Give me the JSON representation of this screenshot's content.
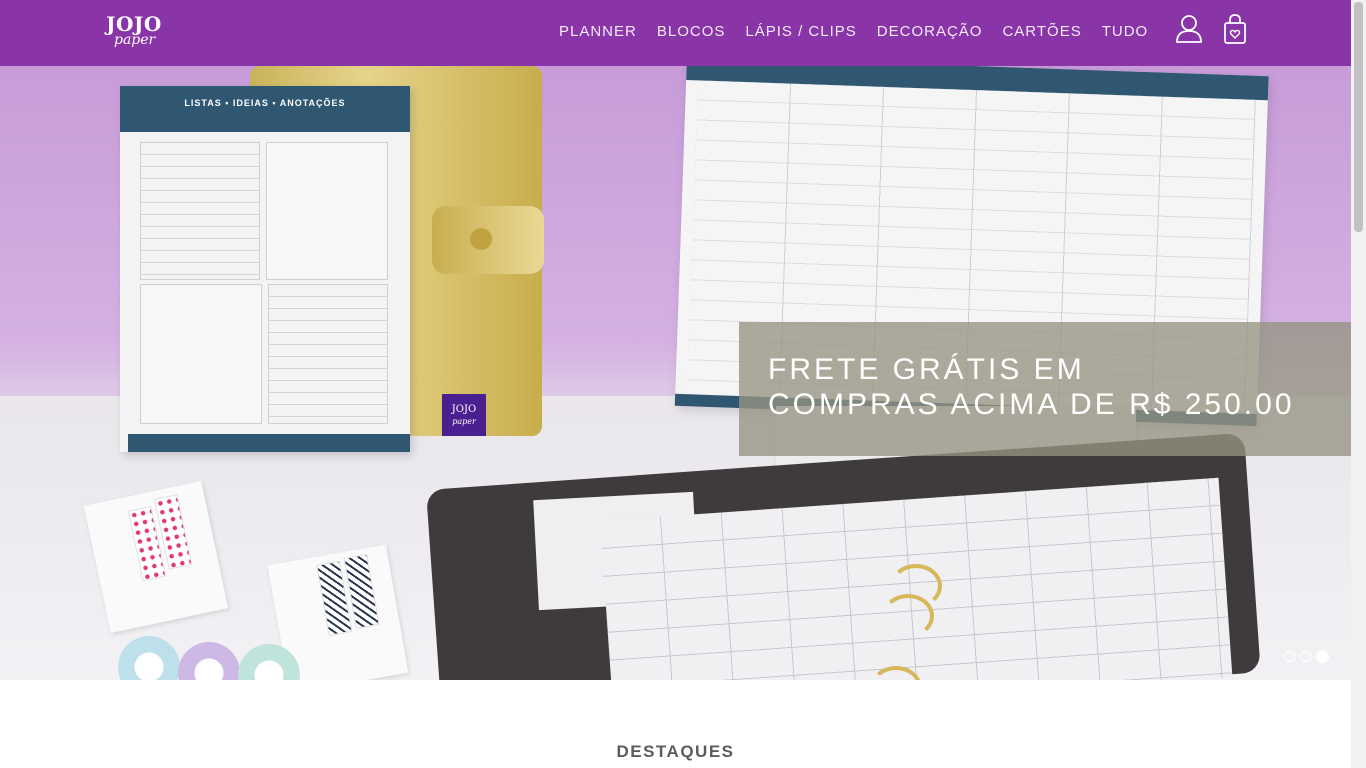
{
  "header": {
    "logo_main": "JOJO",
    "logo_sub": "paper",
    "nav": [
      {
        "label": "PLANNER"
      },
      {
        "label": "BLOCOS"
      },
      {
        "label": "LÁPIS / CLIPS"
      },
      {
        "label": "DECORAÇÃO"
      },
      {
        "label": "CARTÕES"
      },
      {
        "label": "TUDO"
      }
    ],
    "icons": {
      "account": "user-icon",
      "cart": "shopping-bag-icon"
    },
    "background": "#8a35a7"
  },
  "hero": {
    "notepad_title": "LISTAS • IDEIAS • ANOTAÇÕES",
    "tag_main": "JOJO",
    "tag_sub": "paper",
    "banner_line1": "FRETE GRÁTIS EM",
    "banner_line2": "COMPRAS ACIMA DE R$ 250.00",
    "slides": 3,
    "active_slide": 3
  },
  "section": {
    "title": "DESTAQUES"
  }
}
